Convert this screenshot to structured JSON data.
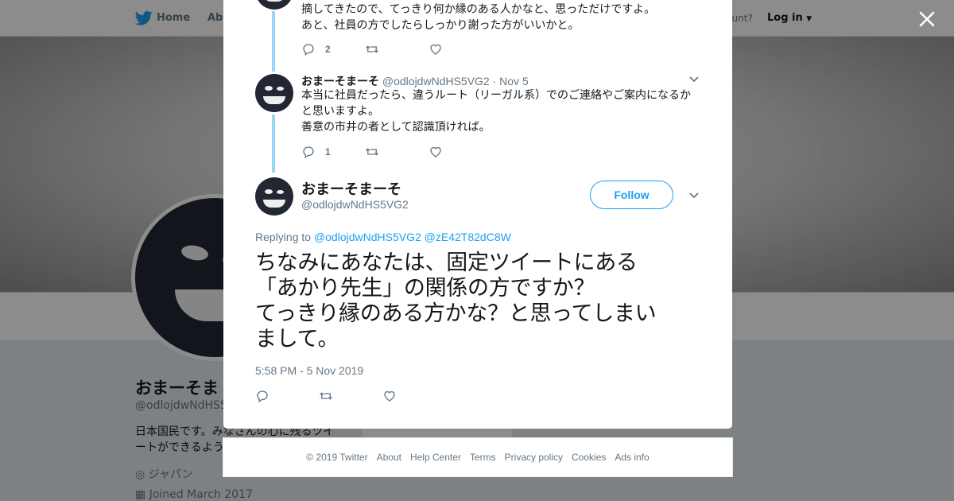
{
  "topbar": {
    "home_label": "Home",
    "about_label": "Abo",
    "account_prompt": "ccount?",
    "login_label": "Log in"
  },
  "profile": {
    "name": "おまーそま",
    "handle": "@odlojdwNdHS5V",
    "bio": "日本国民です。みなさんの心に残るツイートができるよう",
    "location": "ジャパン",
    "joined": "Joined March 2017",
    "side_link": "Ads info"
  },
  "thread": [
    {
      "text_lines": [
        "摘してきたので、てっきり何か縁のある人かなと、思っただけですよ。",
        "あと、社員の方でしたらしっかり謝った方がいいかと。"
      ],
      "reply_count": "2",
      "retweet_count": "",
      "like_count": ""
    },
    {
      "name": "おまーそまーそ",
      "handle": "@odlojdwNdHS5VG2",
      "date": "· Nov 5",
      "text_lines": [
        "本当に社員だったら、違うルート（リーガル系）でのご連絡やご案内になるか",
        "と思いますよ。",
        "善意の市井の者として認識頂ければ。"
      ],
      "reply_count": "1",
      "retweet_count": "",
      "like_count": ""
    }
  ],
  "main_tweet": {
    "name": "おまーそまーそ",
    "handle": "@odlojdwNdHS5VG2",
    "follow_label": "Follow",
    "replying_prefix": "Replying to",
    "replying_to_1": "@odlojdwNdHS5VG2",
    "replying_to_2": "@zE42T82dC8W",
    "text_lines": [
      "ちなみにあなたは、固定ツイートにある",
      "「あかり先生」の関係の方ですか？",
      "てっきり縁のある方かな？と思ってしまい",
      "まして。"
    ],
    "timestamp": "5:58 PM - 5 Nov 2019"
  },
  "footer": {
    "links": [
      "© 2019 Twitter",
      "About",
      "Help Center",
      "Terms",
      "Privacy policy",
      "Cookies",
      "Ads info"
    ]
  },
  "colors": {
    "accent": "#1da1f2",
    "thread_line": "#9bd6f8",
    "secondary_text": "#657786"
  },
  "icons": [
    "twitter-bird-icon",
    "close-icon",
    "reply-icon",
    "retweet-icon",
    "like-icon",
    "chevron-down-icon",
    "location-icon",
    "calendar-icon"
  ]
}
